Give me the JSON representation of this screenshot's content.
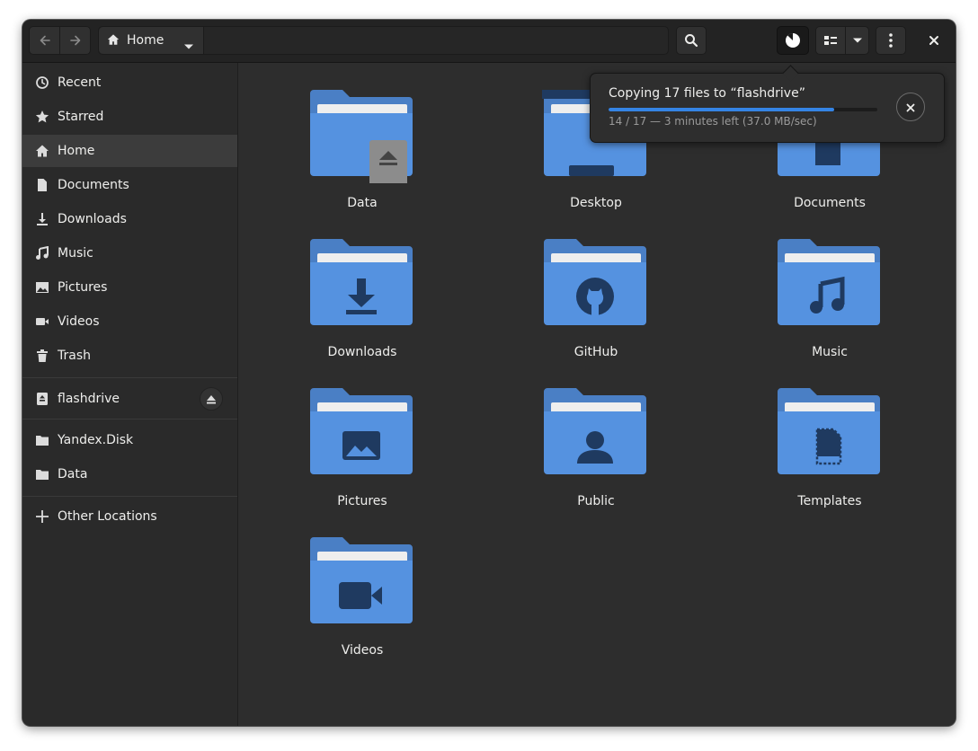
{
  "header": {
    "location_label": "Home",
    "icons": {
      "back": "go-back-icon",
      "forward": "go-forward-icon",
      "home": "home-icon",
      "search": "search-icon",
      "operations": "file-operations-pie-icon",
      "view": "list-view-icon",
      "menu": "open-menu-icon",
      "close": "close-icon"
    }
  },
  "sidebar": {
    "items": [
      {
        "label": "Recent",
        "icon": "clock-icon"
      },
      {
        "label": "Starred",
        "icon": "star-icon"
      },
      {
        "label": "Home",
        "icon": "home-icon",
        "active": true
      },
      {
        "label": "Documents",
        "icon": "document-icon"
      },
      {
        "label": "Downloads",
        "icon": "download-icon"
      },
      {
        "label": "Music",
        "icon": "music-note-icon"
      },
      {
        "label": "Pictures",
        "icon": "image-icon"
      },
      {
        "label": "Videos",
        "icon": "video-camera-icon"
      },
      {
        "label": "Trash",
        "icon": "trash-icon"
      }
    ],
    "devices": [
      {
        "label": "flashdrive",
        "icon": "removable-drive-icon",
        "eject_icon": "eject-icon"
      }
    ],
    "bookmarks": [
      {
        "label": "Yandex.Disk",
        "icon": "folder-icon"
      },
      {
        "label": "Data",
        "icon": "folder-icon"
      }
    ],
    "other_locations": {
      "label": "Other Locations",
      "icon": "plus-icon"
    }
  },
  "folders": [
    {
      "name": "Data",
      "emblem": "eject-emblem-icon"
    },
    {
      "name": "Desktop",
      "emblem": "desktop-icon"
    },
    {
      "name": "Documents",
      "emblem": "document-icon"
    },
    {
      "name": "Downloads",
      "emblem": "download-icon"
    },
    {
      "name": "GitHub",
      "emblem": "github-icon"
    },
    {
      "name": "Music",
      "emblem": "music-note-icon"
    },
    {
      "name": "Pictures",
      "emblem": "image-icon"
    },
    {
      "name": "Public",
      "emblem": "person-icon"
    },
    {
      "name": "Templates",
      "emblem": "template-icon"
    },
    {
      "name": "Videos",
      "emblem": "video-camera-icon"
    }
  ],
  "operation": {
    "title": "Copying 17 files to “flashdrive”",
    "status": "14 / 17 — 3 minutes left (37.0 MB/sec)",
    "progress": 0.84,
    "cancel_icon": "cancel-icon"
  },
  "colors": {
    "accent": "#3584e4",
    "folder_back": "#4a7fc5",
    "folder_front": "#5592e0",
    "folder_paper": "#eeeeee",
    "emblem": "#1f3a60"
  }
}
